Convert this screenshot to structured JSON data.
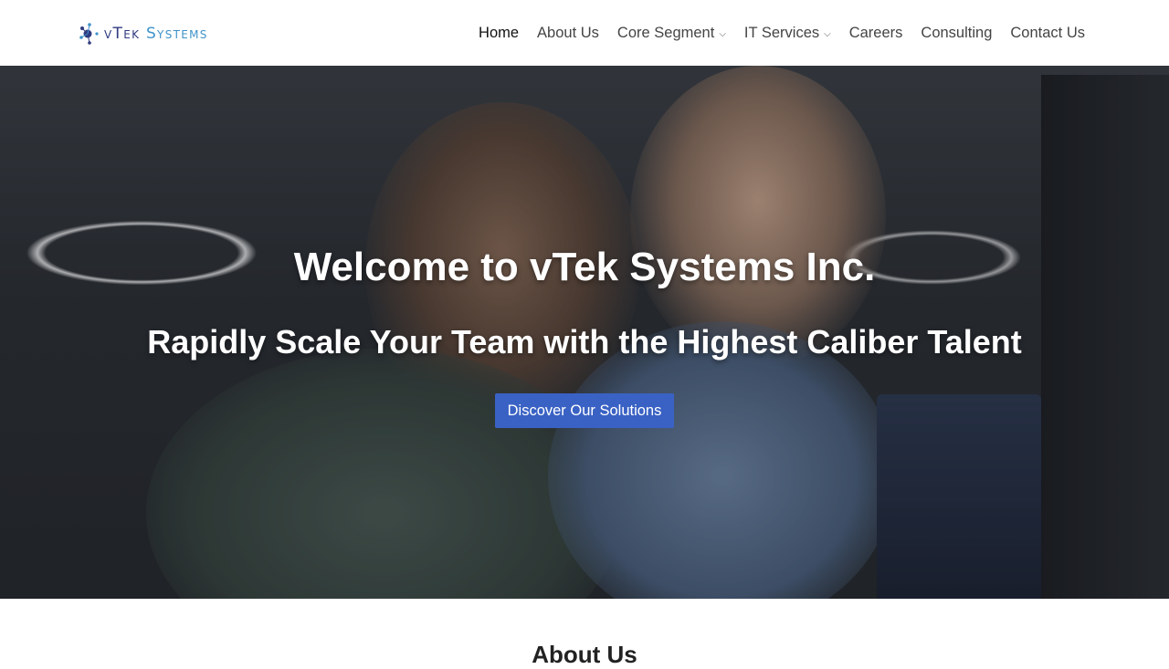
{
  "brand": {
    "logo_text_v": "v",
    "logo_text_tek": "Tek ",
    "logo_text_systems": "Systems",
    "icon": "atom-dots-icon"
  },
  "nav": {
    "home": "Home",
    "about": "About Us",
    "core_segment": "Core Segment",
    "it_services": "IT Services",
    "careers": "Careers",
    "consulting": "Consulting",
    "contact": "Contact Us",
    "chevron": "⌵"
  },
  "hero": {
    "title": "Welcome to vTek Systems Inc.",
    "subtitle": "Rapidly Scale Your Team with the Highest Caliber Talent",
    "cta_label": "Discover Our Solutions"
  },
  "about": {
    "heading": "About Us"
  },
  "colors": {
    "cta_bg": "#3a62c4",
    "logo_dark": "#2f3a80",
    "logo_light": "#3f93c9"
  }
}
